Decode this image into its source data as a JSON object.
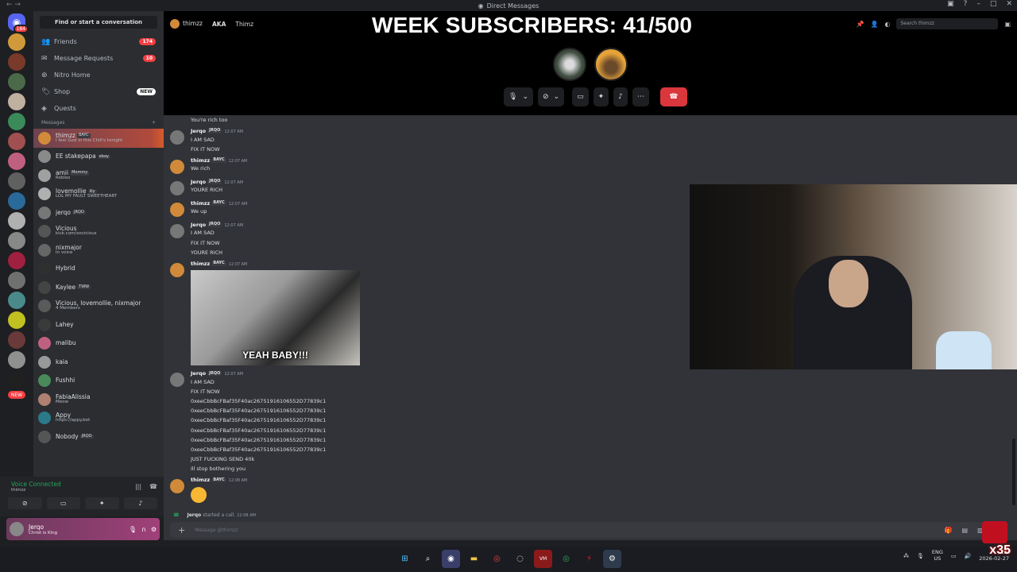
{
  "window": {
    "title": "Direct Messages"
  },
  "overlay": {
    "title": "WEEK SUBSCRIBERS: 41/500"
  },
  "sidebar": {
    "search": "Find or start a conversation",
    "nav": [
      {
        "label": "Friends",
        "badge": "174",
        "icon": "friends-icon"
      },
      {
        "label": "Message Requests",
        "badge": "10",
        "icon": "envelope-icon"
      },
      {
        "label": "Nitro Home",
        "badge": "",
        "icon": "nitro-icon"
      },
      {
        "label": "Shop",
        "badge": "NEW",
        "icon": "shop-icon"
      },
      {
        "label": "Quests",
        "badge": "",
        "icon": "quests-icon"
      }
    ],
    "dm_header": "Messages",
    "dms": [
      {
        "name": "thimzz",
        "tag": "BAYC",
        "sub": "I feel God in this Chili's tonight",
        "color": "#d08a3a"
      },
      {
        "name": "EE stakepapa",
        "tag": "ebay",
        "sub": "",
        "color": "#8a8a8a"
      },
      {
        "name": "amii",
        "tag": "Mommy",
        "sub": "Roblox",
        "color": "#a0a0a0"
      },
      {
        "name": "lovemollie",
        "tag": "lily",
        "sub": "LOL MY FAULT SWEETHEART",
        "color": "#b0b0b0"
      },
      {
        "name": "jerqo",
        "tag": "JRQO",
        "sub": "",
        "color": "#777"
      },
      {
        "name": "Vicious",
        "tag": "",
        "sub": "kick.com/sovicious",
        "color": "#555"
      },
      {
        "name": "nixmajor",
        "tag": "",
        "sub": "In voice",
        "color": "#666"
      },
      {
        "name": "Hybrid",
        "tag": "",
        "sub": "",
        "color": "#2f2f2f"
      },
      {
        "name": "Kaylee",
        "tag": "TWW",
        "sub": "",
        "color": "#444"
      },
      {
        "name": "Vicious, lovemollie, nixmajor",
        "tag": "",
        "sub": "4 Members",
        "color": "#5a5a5a"
      },
      {
        "name": "Lahey",
        "tag": "",
        "sub": "",
        "color": "#3a3a3a"
      },
      {
        "name": "malibu",
        "tag": "",
        "sub": "",
        "color": "#c06080"
      },
      {
        "name": "kaia",
        "tag": "",
        "sub": "",
        "color": "#999"
      },
      {
        "name": "Fushhi",
        "tag": "",
        "sub": "",
        "color": "#4a8a5a"
      },
      {
        "name": "FabiaAlissia",
        "tag": "",
        "sub": "Meow",
        "color": "#b08070"
      },
      {
        "name": "Appy",
        "tag": "",
        "sub": "https://appy.bot",
        "color": "#2a7a8a"
      },
      {
        "name": "Nobody",
        "tag": "JRQO",
        "sub": "",
        "color": "#555"
      }
    ],
    "guild_badges": [
      "184",
      "",
      "",
      "",
      "",
      "",
      "",
      "",
      "",
      "",
      "",
      "",
      "",
      "",
      "",
      "",
      "",
      "",
      "",
      "NEW"
    ]
  },
  "voice": {
    "status": "Voice Connected",
    "channel": "thimzz"
  },
  "user": {
    "name": "Jerqo",
    "status": "Christ is King"
  },
  "call": {
    "header_name": "thimzz",
    "aka_label": "AKA",
    "aka_name": "Thimz",
    "search_placeholder": "Search thimzz"
  },
  "messages": [
    {
      "author": "",
      "time": "",
      "lines": [
        "You're rich too"
      ],
      "continuation": true
    },
    {
      "author": "Jerqo",
      "tag": "JRQO",
      "time": "12:07 AM",
      "lines": [
        "I AM SAD",
        "FIX IT NOW"
      ],
      "color": "#777"
    },
    {
      "author": "thimzz",
      "tag": "BAYC",
      "time": "12:07 AM",
      "lines": [
        "We rich"
      ],
      "color": "#d08a3a"
    },
    {
      "author": "Jerqo",
      "tag": "JRQO",
      "time": "12:07 AM",
      "lines": [
        "YOURE RICH"
      ],
      "color": "#777"
    },
    {
      "author": "thimzz",
      "tag": "BAYC",
      "time": "12:07 AM",
      "lines": [
        "We up"
      ],
      "color": "#d08a3a"
    },
    {
      "author": "Jerqo",
      "tag": "JRQO",
      "time": "12:07 AM",
      "lines": [
        "I AM SAD",
        "FIX IT NOW",
        "YOURE RICH"
      ],
      "color": "#777"
    },
    {
      "author": "thimzz",
      "tag": "BAYC",
      "time": "12:07 AM",
      "lines": [],
      "gif": "YEAH BABY!!!",
      "color": "#d08a3a"
    },
    {
      "author": "Jerqo",
      "tag": "JRQO",
      "time": "12:07 AM",
      "lines": [
        "I AM SAD",
        "FIX IT NOW",
        "0xeeCbbBcFBaf35F40ac26751916106552D77839c1",
        "0xeeCbbBcFBaf35F40ac26751916106552D77839c1",
        "0xeeCbbBcFBaf35F40ac26751916106552D77839c1",
        "0xeeCbbBcFBaf35F40ac26751916106552D77839c1",
        "0xeeCbbBcFBaf35F40ac26751916106552D77839c1",
        "0xeeCbbBcFBaf35F40ac26751916106552D77839c1",
        "JUST FUCKING SEND 40k",
        "ill stop bothering you"
      ],
      "color": "#777"
    },
    {
      "author": "thimzz",
      "tag": "BAYC",
      "time": "12:08 AM",
      "lines": [],
      "emoji": true,
      "color": "#d08a3a"
    }
  ],
  "system_message": {
    "author": "Jerqo",
    "text": "started a call.",
    "time": "12:08 AM"
  },
  "composer": {
    "placeholder": "Message @thimzz"
  },
  "taskbar": {
    "lang1": "ENG",
    "lang2": "US",
    "time": "12:",
    "date": "2026-02-27"
  },
  "stream_overlay": {
    "counter": "x35"
  }
}
